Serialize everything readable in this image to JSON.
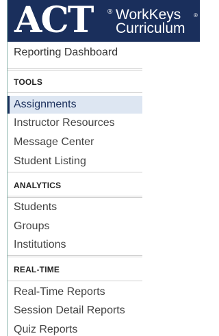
{
  "brand": {
    "logo_text": "ACT",
    "product_line1": "WorkKeys",
    "product_line2": "Curriculum",
    "registered_mark": "®",
    "trademark": "®"
  },
  "dashboard": {
    "title": "Reporting Dashboard"
  },
  "sections": [
    {
      "header": "TOOLS",
      "items": [
        {
          "label": "Assignments",
          "active": true
        },
        {
          "label": "Instructor Resources"
        },
        {
          "label": "Message Center"
        },
        {
          "label": "Student Listing"
        }
      ]
    },
    {
      "header": "ANALYTICS",
      "items": [
        {
          "label": "Students"
        },
        {
          "label": "Groups"
        },
        {
          "label": "Institutions"
        }
      ]
    },
    {
      "header": "REAL-TIME",
      "items": [
        {
          "label": "Real-Time Reports"
        },
        {
          "label": "Session Detail Reports"
        },
        {
          "label": "Quiz Reports"
        }
      ]
    }
  ],
  "colors": {
    "brand_navy": "#1a2f5c",
    "active_bg": "#dde6f2"
  }
}
